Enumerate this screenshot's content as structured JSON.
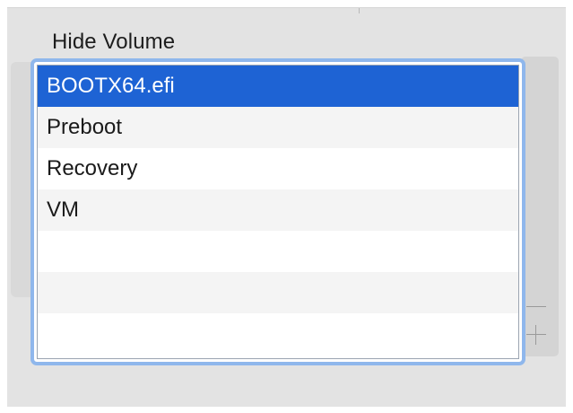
{
  "panel": {
    "title": "Hide Volume"
  },
  "volume_list": {
    "items": [
      {
        "label": "BOOTX64.efi",
        "selected": true
      },
      {
        "label": "Preboot",
        "selected": false
      },
      {
        "label": "Recovery",
        "selected": false
      },
      {
        "label": "VM",
        "selected": false
      },
      {
        "label": "",
        "selected": false
      },
      {
        "label": "",
        "selected": false
      },
      {
        "label": "",
        "selected": false
      }
    ]
  },
  "controls": {
    "remove_icon": "minus-icon",
    "add_icon": "plus-icon"
  },
  "colors": {
    "selection": "#1e63d4",
    "focus_ring": "#8fb7ec",
    "background": "#e3e3e3"
  }
}
